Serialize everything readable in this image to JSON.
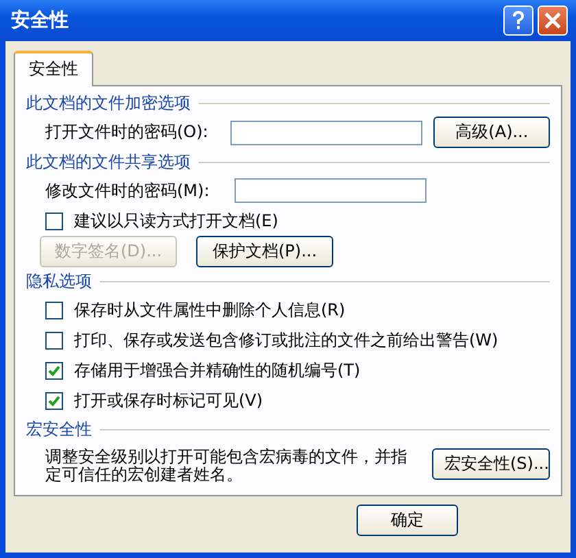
{
  "window": {
    "title": "安全性"
  },
  "tabs": [
    {
      "label": "安全性",
      "selected": true
    }
  ],
  "sections": [
    {
      "heading": "此文档的文件加密选项",
      "rows": [
        {
          "kind": "field",
          "label": "打开文件时的密码(O):",
          "button": "高级(A)..."
        }
      ]
    },
    {
      "heading": "此文档的文件共享选项",
      "rows": [
        {
          "kind": "field",
          "label": "修改文件时的密码(M):"
        },
        {
          "kind": "checkbox",
          "label": "建议以只读方式打开文档(E)",
          "checked": false
        },
        {
          "kind": "buttons",
          "buttons": [
            {
              "label": "数字签名(D)...",
              "disabled": true
            },
            {
              "label": "保护文档(P)...",
              "disabled": false
            }
          ]
        }
      ]
    },
    {
      "heading": "隐私选项",
      "rows": [
        {
          "kind": "checkbox",
          "label": "保存时从文件属性中删除个人信息(R)",
          "checked": false
        },
        {
          "kind": "checkbox",
          "label": "打印、保存或发送包含修订或批注的文件之前给出警告(W)",
          "checked": false
        },
        {
          "kind": "checkbox",
          "label": "存储用于增强合并精确性的随机编号(T)",
          "checked": true
        },
        {
          "kind": "checkbox",
          "label": "打开或保存时标记可见(V)",
          "checked": true
        }
      ]
    },
    {
      "heading": "宏安全性",
      "rows": [
        {
          "kind": "text_button",
          "text": "调整安全级别以打开可能包含宏病毒的文件，并指定可信任的宏创建者姓名。",
          "button": "宏安全性(S)..."
        }
      ]
    }
  ],
  "footer_buttons": [
    "确定"
  ]
}
